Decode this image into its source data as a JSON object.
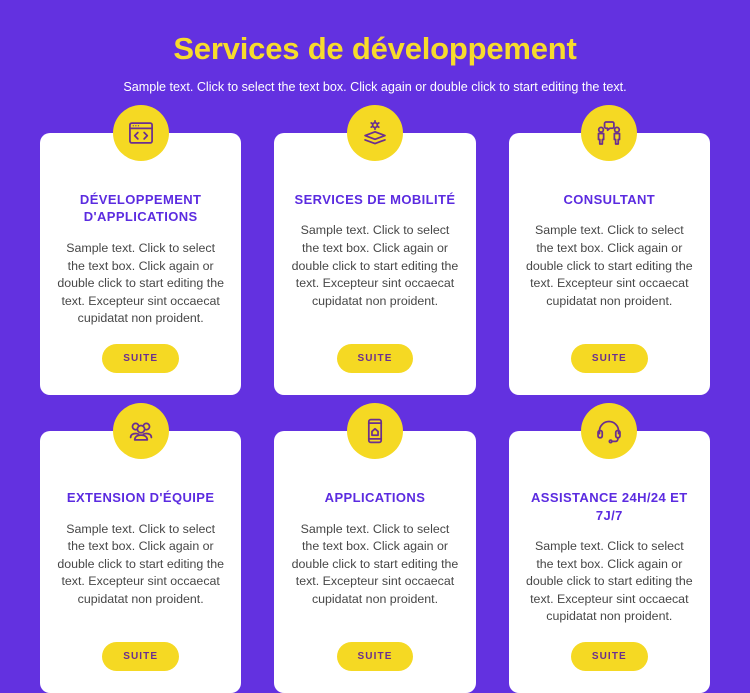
{
  "theme": {
    "background": "#6331e0",
    "accent_yellow": "#f5d923",
    "title_yellow": "#f7db2c",
    "heading_purple": "#5b2be0",
    "body_gray": "#474747",
    "button_text": "#6b2f8f",
    "card_background": "#ffffff"
  },
  "hero": {
    "title": "Services de développement",
    "subtitle": "Sample text. Click to select the text box. Click again or double click to start editing the text."
  },
  "cards": [
    {
      "icon": "code-window-icon",
      "title": "Développement d'applications",
      "text": "Sample text. Click to select the text box. Click again or double click to start editing the text. Excepteur sint occaecat cupidatat non proident.",
      "button": "SUITE"
    },
    {
      "icon": "layers-settings-icon",
      "title": "Services de mobilité",
      "text": "Sample text. Click to select the text box. Click again or double click to start editing the text. Excepteur sint occaecat cupidatat non proident.",
      "button": "SUITE"
    },
    {
      "icon": "consulting-people-icon",
      "title": "Consultant",
      "text": "Sample text. Click to select the text box. Click again or double click to start editing the text. Excepteur sint occaecat cupidatat non proident.",
      "button": "SUITE"
    },
    {
      "icon": "team-group-icon",
      "title": "Extension d'équipe",
      "text": "Sample text. Click to select the text box. Click again or double click to start editing the text. Excepteur sint occaecat cupidatat non proident.",
      "button": "SUITE"
    },
    {
      "icon": "mobile-app-icon",
      "title": "Applications",
      "text": "Sample text. Click to select the text box. Click again or double click to start editing the text. Excepteur sint occaecat cupidatat non proident.",
      "button": "SUITE"
    },
    {
      "icon": "headset-support-icon",
      "title": "Assistance 24H/24 et 7J/7",
      "text": "Sample text. Click to select the text box. Click again or double click to start editing the text. Excepteur sint occaecat cupidatat non proident.",
      "button": "SUITE"
    }
  ]
}
